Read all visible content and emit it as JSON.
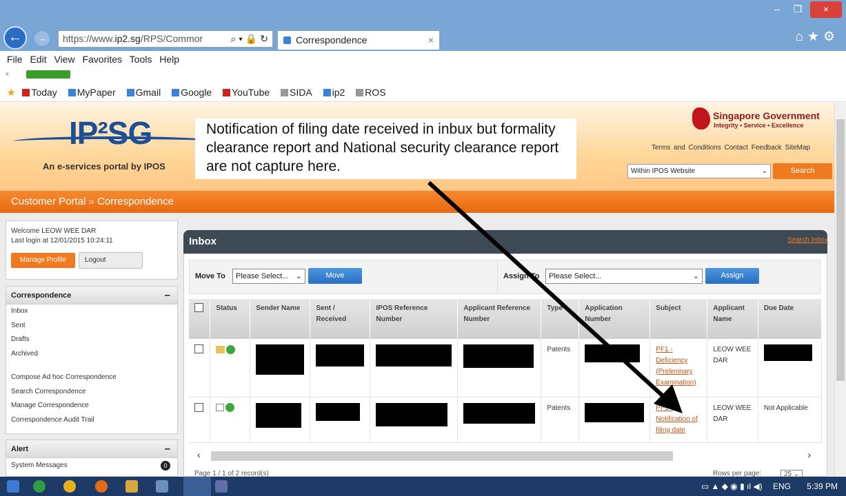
{
  "browser": {
    "url_prefix": "https://www.",
    "url_domain": "ip2.sg",
    "url_path": "/RPS/Commor",
    "tab_title": "Correspondence",
    "tab_close": "×",
    "menu": [
      "File",
      "Edit",
      "View",
      "Favorites",
      "Tools",
      "Help"
    ],
    "favorites": [
      "Today",
      "MyPaper",
      "Gmail",
      "Google",
      "YouTube",
      "SIDA",
      "ip2",
      "ROS"
    ]
  },
  "header": {
    "logo": "IP²SG",
    "tagline": "An e-services portal by IPOS",
    "gov_name": "Singapore Government",
    "gov_motto": "Integrity • Service • Excellence",
    "top_links": "Terms and Conditions   Contact   Feedback   SiteMap",
    "search_scope": "Within IPOS Website",
    "search_button": "Search"
  },
  "callout": {
    "text": "Notification of filing date received in inbux but formality clearance report and National security clearance report are not capture here."
  },
  "breadcrumb": {
    "root": "Customer Portal",
    "separator": "»",
    "current": "Correspondence"
  },
  "sidebar": {
    "welcome": "Welcome LEOW WEE DAR",
    "last_login": "Last login at 12/01/2015 10:24:11",
    "manage_profile": "Manage Profile",
    "logout": "Logout",
    "correspondence_title": "Correspondence",
    "correspondence_items": [
      "Inbox",
      "Sent",
      "Drafts",
      "Archived"
    ],
    "correspondence_items2": [
      "Compose Ad hoc Correspondence",
      "Search Correspondence",
      "Manage Correspondence",
      "Correspondence Audit Trail"
    ],
    "alert_title": "Alert",
    "alert_item": "System Messages",
    "alert_count": "0",
    "collapse": "–"
  },
  "inbox": {
    "title": "Inbox",
    "search_link": "Search Inbox",
    "move_to_label": "Move To",
    "move_to_value": "Please Select...",
    "move_button": "Move",
    "assign_to_label": "Assign To",
    "assign_to_value": "Please Select...",
    "assign_button": "Assign",
    "columns": [
      "Status",
      "Sender Name",
      "Sent / Received",
      "IPOS Reference Number",
      "Applicant Reference Number",
      "Type",
      "Application Number",
      "Subject",
      "Applicant Name",
      "Due Date"
    ],
    "rows": [
      {
        "type": "Patents",
        "subject": "PF1 - Deficiency (Preliminary Examination)",
        "applicant": "LEOW WEE DAR",
        "due": ""
      },
      {
        "type": "Patents",
        "subject": "PF1 - Notification of filing date",
        "applicant": "LEOW WEE DAR",
        "due": "Not Applicable"
      }
    ],
    "pager_text": "Page 1 / 1 of 2 record(s)",
    "rows_per_page_label": "Rows per page:",
    "rows_per_page": "25"
  },
  "taskbar": {
    "lang": "ENG",
    "time": "5:39 PM"
  }
}
